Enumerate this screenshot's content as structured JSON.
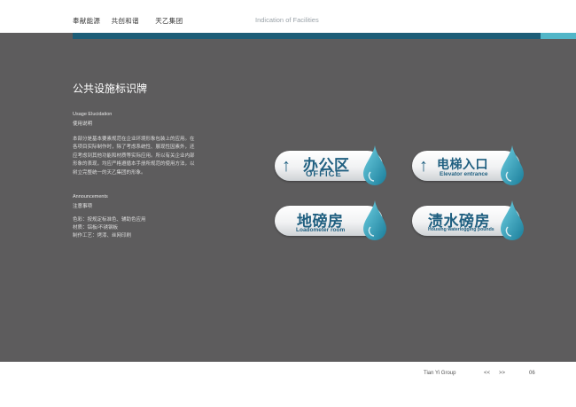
{
  "header": {
    "slogan_1": "奉献能源",
    "slogan_2": "共创和谐",
    "company": "天乙集团",
    "section": "Indication of Facilities"
  },
  "colors": {
    "bar_dark": "#1d5d77",
    "bar_light": "#52b6c8",
    "panel": "#5d5c5d",
    "sign_text": "#1f5f80"
  },
  "main": {
    "title": "公共设施标识牌",
    "usage": {
      "label_en": "Usage Elucidation",
      "label_cn": "使用说明",
      "lines": [
        "本部分是基本要素规范在企业环境形象包装上的应用。在",
        "各项目实际制作时，除了考虑系统性、展现性因素外，还",
        "应考虑到其他功能和材质等实际应用。所以有关企业内部",
        "形象的表现，均应严格遵循本手册所规范的使用方法，以",
        "树立完整统一的天乙集团的形象。"
      ]
    },
    "announce": {
      "label_en": "Announcements",
      "label_cn": "注意事项",
      "items": [
        "色彩：按规定标准色、辅助色应用",
        "材质：铝板/不锈钢板",
        "制作工艺：烤漆、丝网印刷"
      ]
    }
  },
  "signs": [
    {
      "arrow": "↑",
      "cn": "办公区",
      "en": "OFFICE",
      "icon": "water-drop-icon"
    },
    {
      "arrow": "↑",
      "cn": "电梯入口",
      "en": "Elevator entrance",
      "icon": "water-drop-icon"
    },
    {
      "arrow": "",
      "cn": "地磅房",
      "en": "Loadometer room",
      "icon": "water-drop-icon"
    },
    {
      "arrow": "",
      "cn": "渍水磅房",
      "en": "Housing waterlogging pounds",
      "icon": "water-drop-icon"
    }
  ],
  "footer": {
    "brand": "Tian Yi Group",
    "prev": "<<",
    "next": ">>",
    "page": "06"
  }
}
